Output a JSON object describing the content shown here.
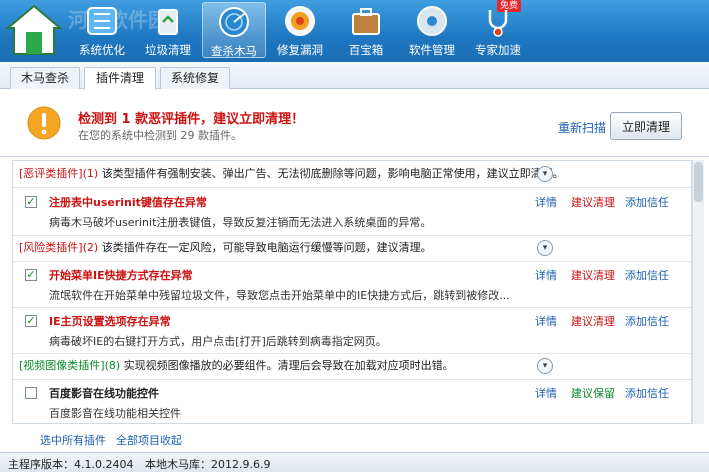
{
  "toolbar": {
    "watermark": "河东软件园",
    "badge": "免费",
    "items": [
      {
        "label": "系统优化",
        "icon": "tune-icon"
      },
      {
        "label": "垃圾清理",
        "icon": "recycle-icon"
      },
      {
        "label": "查杀木马",
        "icon": "radar-icon"
      },
      {
        "label": "修复漏洞",
        "icon": "shield-repair-icon"
      },
      {
        "label": "百宝箱",
        "icon": "toolbox-icon"
      },
      {
        "label": "软件管理",
        "icon": "disc-icon"
      },
      {
        "label": "专家加速",
        "icon": "stethoscope-icon"
      }
    ]
  },
  "subtabs": [
    "木马查杀",
    "插件清理",
    "系统修复"
  ],
  "alert": {
    "title": "检测到 1 款恶评插件，建议立即清理！",
    "subtitle": "在您的系统中检测到 29 款插件。",
    "rescan": "重新扫描",
    "clean_now": "立即清理"
  },
  "categories": [
    {
      "name": "[恶评类插件]",
      "count": "(1)",
      "desc": "该类型插件有强制安装、弹出广告、无法彻底删除等问题，影响电脑正常使用，建议立即清理。"
    },
    {
      "name": "[风险类插件]",
      "count": "(2)",
      "desc": "该类插件存在一定风险，可能导致电脑运行缓慢等问题，建议清理。"
    },
    {
      "name": "[视频图像类插件]",
      "count": "(8)",
      "desc": "实现视频图像播放的必要组件。清理后会导致在加载对应项时出错。"
    }
  ],
  "items": [
    {
      "name": "注册表中userinit键值存在异常",
      "desc": "病毒木马破坏userinit注册表键值，导致反复注销而无法进入系统桌面的异常。",
      "details": "详情",
      "action": "建议清理",
      "trust": "添加信任",
      "checked": true
    },
    {
      "name": "开始菜单IE快捷方式存在异常",
      "desc": "流氓软件在开始菜单中残留垃圾文件，导致您点击开始菜单中的IE快捷方式后，跳转到被修改...",
      "details": "详情",
      "action": "建议清理",
      "trust": "添加信任",
      "checked": true
    },
    {
      "name": "IE主页设置选项存在异常",
      "desc": "病毒破坏IE的右键打开方式，用户点击[打开]后跳转到病毒指定网页。",
      "details": "详情",
      "action": "建议清理",
      "trust": "添加信任",
      "checked": true
    },
    {
      "name": "百度影音在线功能控件",
      "desc": "百度影音在线功能相关控件",
      "details": "详情",
      "action": "建议保留",
      "trust": "添加信任",
      "checked": false
    }
  ],
  "bottom": {
    "select_all": "选中所有插件",
    "collapse_all": "全部项目收起"
  },
  "status": {
    "version": "主程序版本：4.1.0.2404",
    "db": "本地木马库：2012.9.6.9"
  }
}
